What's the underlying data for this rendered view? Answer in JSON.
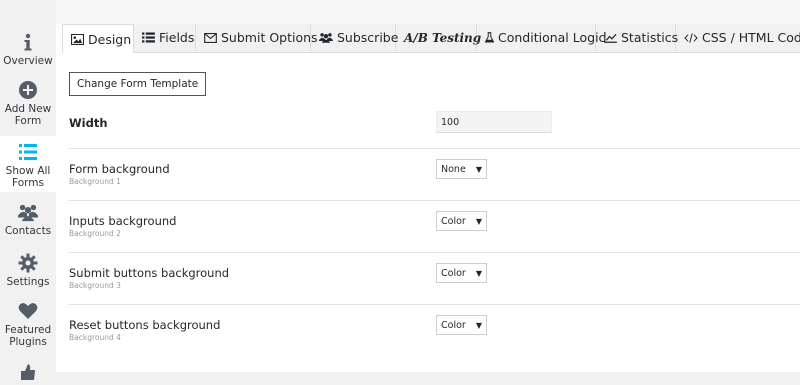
{
  "sidebar": {
    "items": [
      {
        "label_line1": "Overview",
        "label_line2": "",
        "icon": "info-icon"
      },
      {
        "label_line1": "Add New",
        "label_line2": "Form",
        "icon": "plus-circle-icon"
      },
      {
        "label_line1": "Show All",
        "label_line2": "Forms",
        "icon": "list-icon",
        "active": true
      },
      {
        "label_line1": "Contacts",
        "label_line2": "",
        "icon": "users-icon"
      },
      {
        "label_line1": "Settings",
        "label_line2": "",
        "icon": "gear-icon"
      },
      {
        "label_line1": "Featured",
        "label_line2": "Plugins",
        "icon": "heart-icon"
      }
    ]
  },
  "tabs": [
    {
      "label": "Design",
      "icon": "image-icon",
      "active": true
    },
    {
      "label": "Fields",
      "icon": "list-icon"
    },
    {
      "label": "Submit Options",
      "icon": "envelope-icon"
    },
    {
      "label": "Subscribe",
      "icon": "users-icon"
    },
    {
      "label": "A/B Testing",
      "icon": "ab-icon"
    },
    {
      "label": "Conditional Logic",
      "icon": "flask-icon"
    },
    {
      "label": "Statistics",
      "icon": "chart-line-icon"
    },
    {
      "label": "CSS / HTML Code",
      "icon": "code-icon"
    }
  ],
  "design": {
    "template_button": "Change Form Template",
    "width": {
      "label": "Width",
      "value": "100"
    },
    "rows": [
      {
        "title": "Form background",
        "subtitle": "Background 1",
        "value": "None"
      },
      {
        "title": "Inputs background",
        "subtitle": "Background 2",
        "value": "Color"
      },
      {
        "title": "Submit buttons background",
        "subtitle": "Background 3",
        "value": "Color"
      },
      {
        "title": "Reset buttons background",
        "subtitle": "Background 4",
        "value": "Color"
      }
    ]
  },
  "colors": {
    "accent": "#00b9eb",
    "sidebar_icon": "#555d66"
  }
}
